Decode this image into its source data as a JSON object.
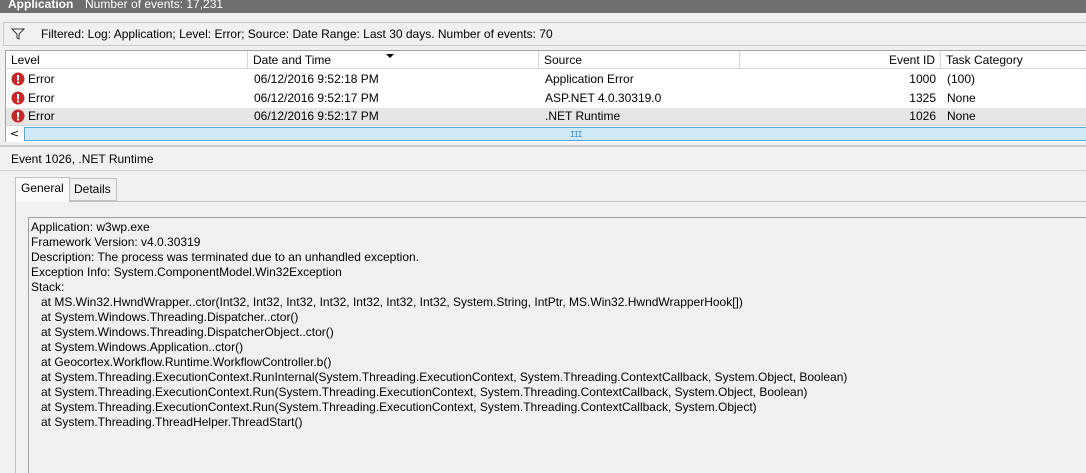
{
  "header": {
    "title": "Application",
    "events_count": "Number of events: 17,231"
  },
  "filter": {
    "icon": "filter-icon",
    "text": "Filtered: Log: Application; Level: Error; Source: Date Range: Last 30 days. Number of events: 70"
  },
  "grid": {
    "columns": [
      "Level",
      "Date and Time",
      "Source",
      "Event ID",
      "Task Category"
    ],
    "sorted_column": "Date and Time",
    "rows": [
      {
        "level": "Error",
        "date": "06/12/2016 9:52:18 PM",
        "source": "Application Error",
        "event_id": "1000",
        "task": "(100)",
        "selected": false
      },
      {
        "level": "Error",
        "date": "06/12/2016 9:52:17 PM",
        "source": "ASP.NET 4.0.30319.0",
        "event_id": "1325",
        "task": "None",
        "selected": false
      },
      {
        "level": "Error",
        "date": "06/12/2016 9:52:17 PM",
        "source": ".NET Runtime",
        "event_id": "1026",
        "task": "None",
        "selected": true
      }
    ],
    "scroll_left": "<",
    "scroll_grip": "III"
  },
  "details": {
    "title": "Event 1026, .NET Runtime",
    "tabs": [
      "General",
      "Details"
    ],
    "active_tab": "General",
    "lines": [
      "Application: w3wp.exe",
      "Framework Version: v4.0.30319",
      "Description: The process was terminated due to an unhandled exception.",
      "Exception Info: System.ComponentModel.Win32Exception",
      "Stack:",
      "   at MS.Win32.HwndWrapper..ctor(Int32, Int32, Int32, Int32, Int32, Int32, Int32, System.String, IntPtr, MS.Win32.HwndWrapperHook[])",
      "   at System.Windows.Threading.Dispatcher..ctor()",
      "   at System.Windows.Threading.DispatcherObject..ctor()",
      "   at System.Windows.Application..ctor()",
      "   at Geocortex.Workflow.Runtime.WorkflowController.b()",
      "   at System.Threading.ExecutionContext.RunInternal(System.Threading.ExecutionContext, System.Threading.ContextCallback, System.Object, Boolean)",
      "   at System.Threading.ExecutionContext.Run(System.Threading.ExecutionContext, System.Threading.ContextCallback, System.Object, Boolean)",
      "   at System.Threading.ExecutionContext.Run(System.Threading.ExecutionContext, System.Threading.ContextCallback, System.Object)",
      "   at System.Threading.ThreadHelper.ThreadStart()"
    ]
  },
  "colors": {
    "titlebar": "#6e6e6e",
    "selected_row": "#e5e5e5",
    "scroll_thumb": "#cfe9f6",
    "error_icon": "#c62828"
  }
}
